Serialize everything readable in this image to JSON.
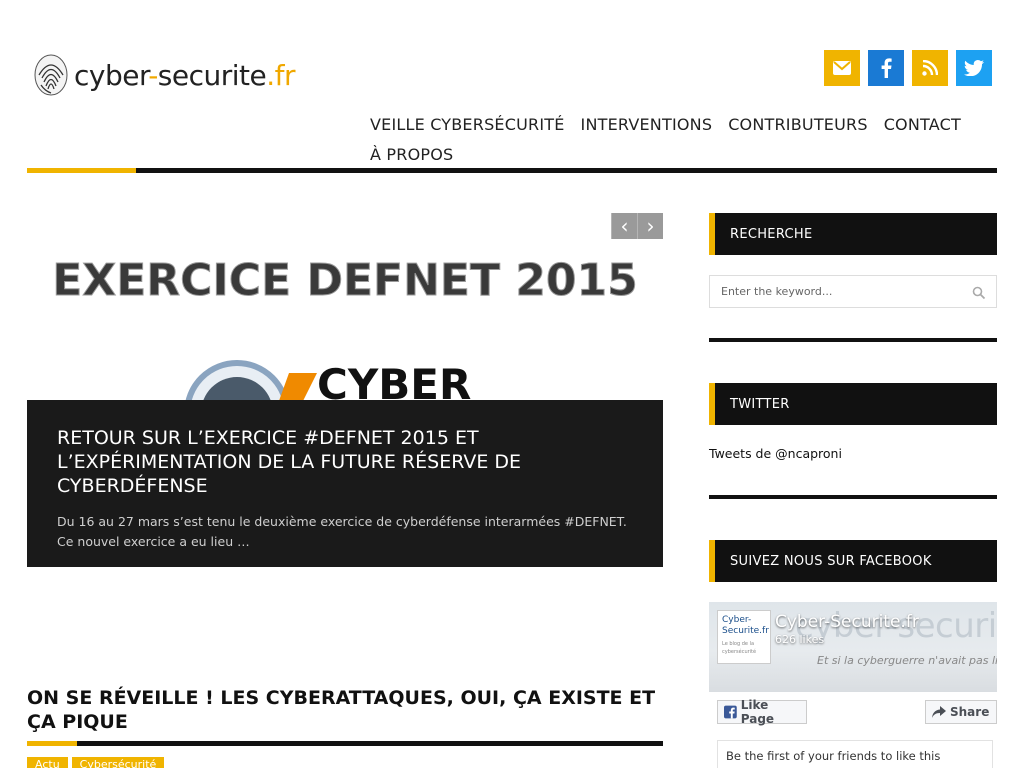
{
  "logo": {
    "text_main": "cyber",
    "text_dash": "-",
    "text_rest": "securite",
    "text_tld": ".fr"
  },
  "social": [
    {
      "icon": "mail-icon",
      "color": "#f0b400"
    },
    {
      "icon": "facebook-icon",
      "color": "#1a7ad4"
    },
    {
      "icon": "rss-icon",
      "color": "#f0b400"
    },
    {
      "icon": "twitter-icon",
      "color": "#1da1f2"
    }
  ],
  "nav": {
    "items": [
      "VEILLE CYBERSÉCURITÉ",
      "INTERVENTIONS",
      "CONTRIBUTEURS",
      "CONTACT",
      "À PROPOS"
    ]
  },
  "slider": {
    "image_heading": "EXERCICE DEFNET 2015",
    "image_logo_text": "CYBER",
    "prev": "‹",
    "next": "›",
    "title": "RETOUR SUR L’EXERCICE #DEFNET 2015 ET L’EXPÉRIMENTATION DE LA FUTURE RÉSERVE DE CYBERDÉFENSE",
    "excerpt": "Du 16 au 27 mars s’est tenu le deuxième exercice de cyberdéfense interarmées #DEFNET. Ce nouvel exercice a eu lieu …"
  },
  "article": {
    "title": "ON SE RÉVEILLE ! LES CYBERATTAQUES, OUI, ÇA EXISTE ET ÇA PIQUE",
    "tags": [
      "Actu",
      "Cybersécurité"
    ]
  },
  "sidebar": {
    "search_title": "RECHERCHE",
    "search_placeholder": "Enter the keyword...",
    "twitter_title": "TWITTER",
    "tweets_label": "Tweets de @ncaproni",
    "facebook_title": "SUIVEZ NOUS SUR FACEBOOK",
    "fb": {
      "cover_text": "cyber-securite.fr",
      "cover_sub": "Et si la cyberguerre n'avait pas li",
      "thumb_line1": "Cyber-",
      "thumb_line2": "Securite.fr",
      "thumb_line3": "Le blog de la cybersécurité",
      "page_name": "Cyber-Securite.fr",
      "likes": "626 likes",
      "like_button": "Like Page",
      "share_button": "Share",
      "friends_text": "Be the first of your friends to like this"
    }
  },
  "colors": {
    "accent": "#f0b400",
    "dark": "#111111"
  }
}
